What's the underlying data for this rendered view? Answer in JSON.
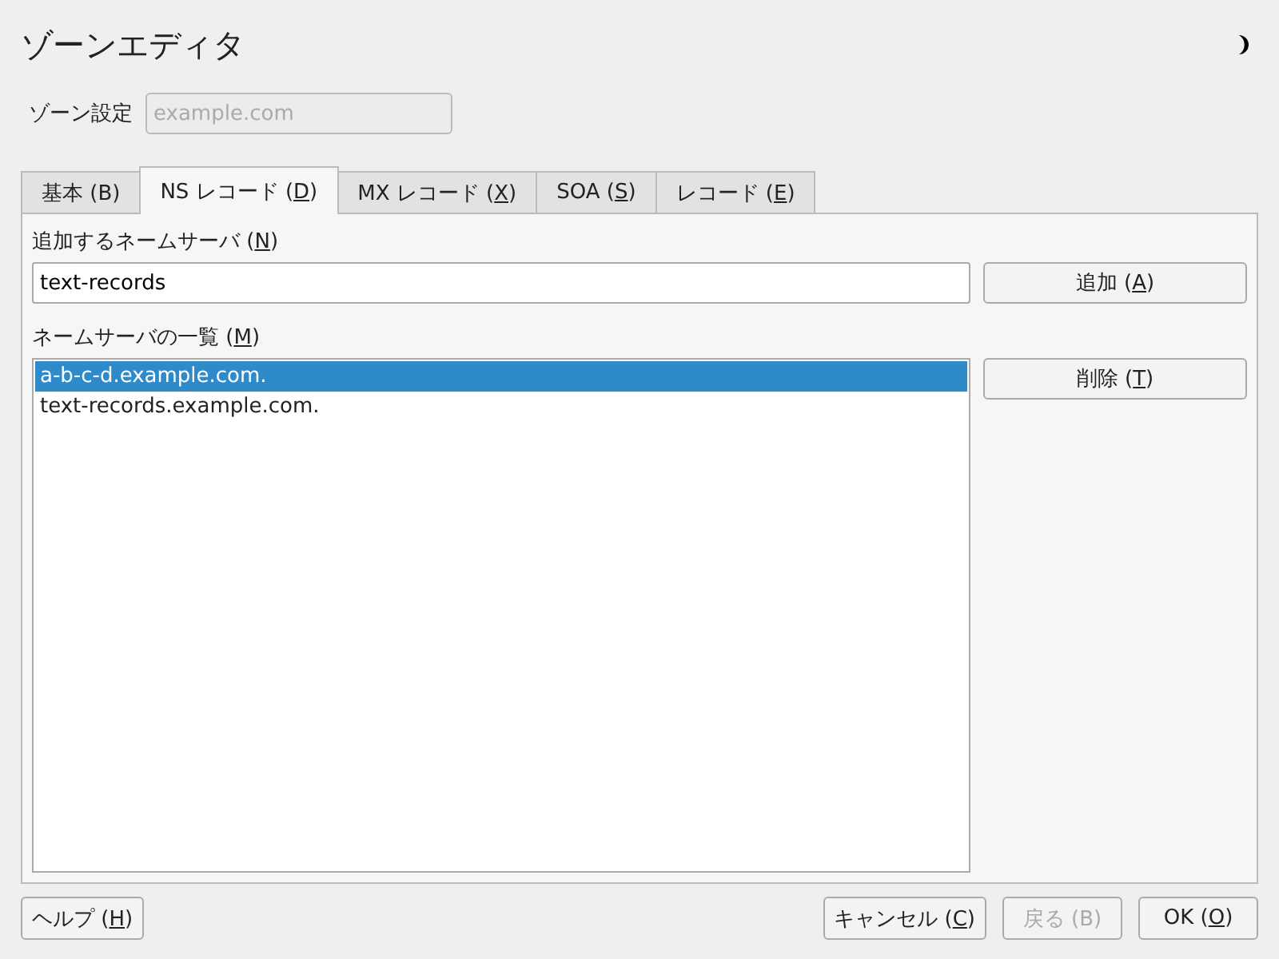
{
  "window": {
    "title": "ゾーンエディタ"
  },
  "zone": {
    "label": "ゾーン設定",
    "value": "example.com",
    "disabled": true
  },
  "tabs": [
    {
      "prefix": "基本 (B)",
      "selected": false
    },
    {
      "prefix": "NS レコード (",
      "key": "D",
      "suffix": ")",
      "selected": true
    },
    {
      "prefix": "MX レコード (",
      "key": "X",
      "suffix": ")",
      "selected": false
    },
    {
      "prefix": "SOA (",
      "key": "S",
      "suffix": ")",
      "selected": false
    },
    {
      "prefix": "レコード (",
      "key": "E",
      "suffix": ")",
      "selected": false
    }
  ],
  "add_label": {
    "prefix": "追加するネームサーバ (",
    "key": "N",
    "suffix": ")"
  },
  "add_field": {
    "value": "text-records"
  },
  "add_button": {
    "prefix": "追加 (",
    "key": "A",
    "suffix": ")",
    "disabled": false
  },
  "list_label": {
    "prefix": "ネームサーバの一覧 (",
    "key": "M",
    "suffix": ")"
  },
  "servers": [
    {
      "name": "a-b-c-d.example.com.",
      "selected": true
    },
    {
      "name": "text-records.example.com.",
      "selected": false
    }
  ],
  "delete_button": {
    "prefix": "削除 (",
    "key": "T",
    "suffix": ")",
    "disabled": false
  },
  "footer": {
    "left": [
      {
        "prefix": "ヘルプ (",
        "key": "H",
        "suffix": ")",
        "disabled": false
      }
    ],
    "right": [
      {
        "prefix": "キャンセル (",
        "key": "C",
        "suffix": ")",
        "disabled": false
      },
      {
        "prefix": "戻る (B)",
        "disabled": true
      },
      {
        "prefix": "OK (",
        "key": "O",
        "suffix": ")",
        "disabled": false
      }
    ]
  }
}
